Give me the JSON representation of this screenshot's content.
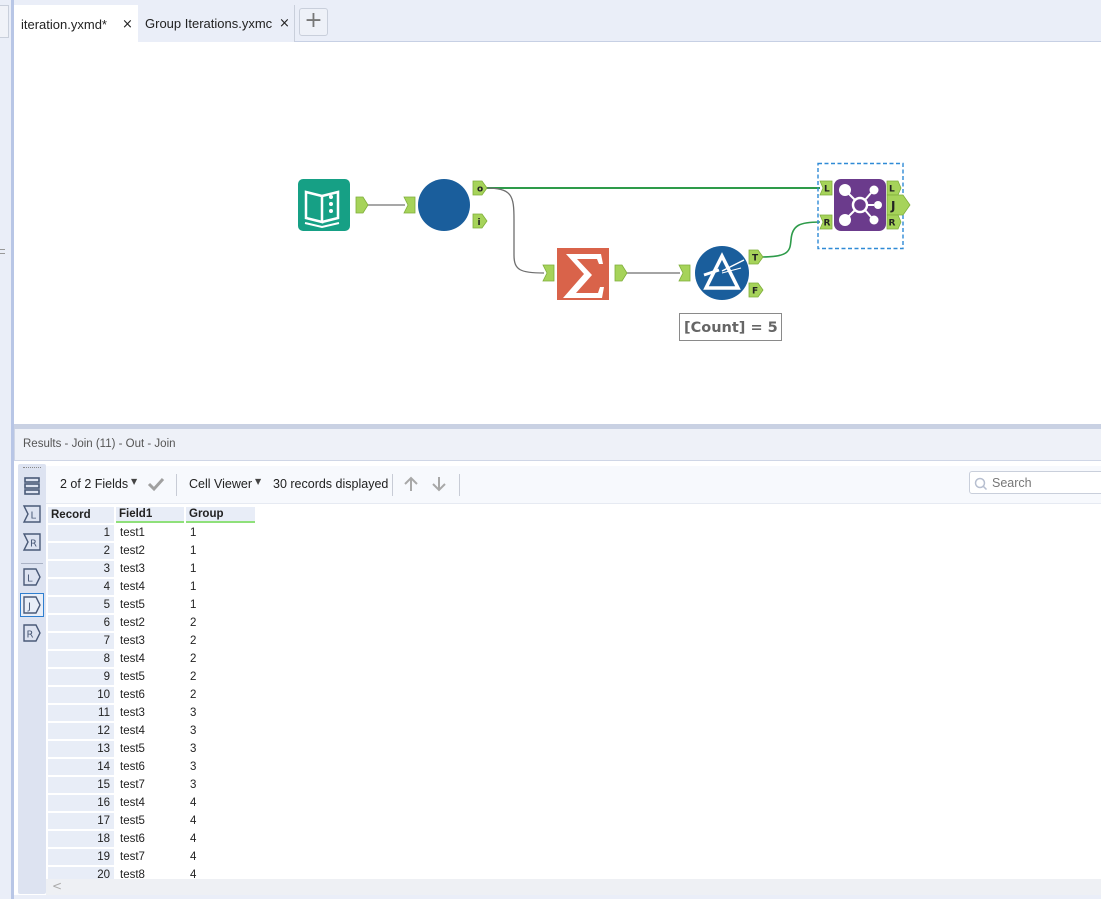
{
  "tabs": [
    {
      "label": "iteration.yxmd*",
      "active": true,
      "close_icon": "×"
    },
    {
      "label": "Group Iterations.yxmc",
      "active": false,
      "close_icon": "×"
    }
  ],
  "add_tab_label": "+",
  "workflow": {
    "tools": [
      {
        "id": "input",
        "name": "Input Data",
        "icon": "book-icon",
        "color": "#16a085"
      },
      {
        "id": "macro",
        "name": "Iterative Macro (Group Iterations)",
        "icon": "circle-icon",
        "color": "#1a5e9c",
        "anchors": [
          "o",
          "i"
        ]
      },
      {
        "id": "summarize",
        "name": "Summarize",
        "icon": "sigma-icon",
        "color": "#d9634a"
      },
      {
        "id": "filter",
        "name": "Filter",
        "icon": "filter-prism-icon",
        "color": "#1a5e9c",
        "anchors": [
          "T",
          "F"
        ],
        "annotation": "[Count] = 5"
      },
      {
        "id": "join",
        "name": "Join",
        "icon": "join-icon",
        "color": "#6b3b8c",
        "input_anchors": [
          "L",
          "R"
        ],
        "output_anchors": [
          "L",
          "J",
          "R"
        ],
        "selected": true
      }
    ],
    "anchor_color": "#a6d35a",
    "connection_color": "#2e9b4a"
  },
  "results": {
    "header": "Results - Join (11) - Out - Join",
    "fields_label": "2 of 2 Fields",
    "cell_viewer_label": "Cell Viewer",
    "records_label": "30 records displayed",
    "search_placeholder": "Search",
    "side_buttons": [
      "table-view",
      "L-input",
      "R-input",
      "L-output",
      "J-output",
      "R-output"
    ],
    "side_labels": {
      "L": "L",
      "R": "R",
      "J": "J"
    },
    "columns": [
      "Record",
      "Field1",
      "Group"
    ],
    "rows": [
      [
        "1",
        "test1",
        "1"
      ],
      [
        "2",
        "test2",
        "1"
      ],
      [
        "3",
        "test3",
        "1"
      ],
      [
        "4",
        "test4",
        "1"
      ],
      [
        "5",
        "test5",
        "1"
      ],
      [
        "6",
        "test2",
        "2"
      ],
      [
        "7",
        "test3",
        "2"
      ],
      [
        "8",
        "test4",
        "2"
      ],
      [
        "9",
        "test5",
        "2"
      ],
      [
        "10",
        "test6",
        "2"
      ],
      [
        "11",
        "test3",
        "3"
      ],
      [
        "12",
        "test4",
        "3"
      ],
      [
        "13",
        "test5",
        "3"
      ],
      [
        "14",
        "test6",
        "3"
      ],
      [
        "15",
        "test7",
        "3"
      ],
      [
        "16",
        "test4",
        "4"
      ],
      [
        "17",
        "test5",
        "4"
      ],
      [
        "18",
        "test6",
        "4"
      ],
      [
        "19",
        "test7",
        "4"
      ],
      [
        "20",
        "test8",
        "4"
      ]
    ],
    "scroll_left_icon": "<"
  }
}
